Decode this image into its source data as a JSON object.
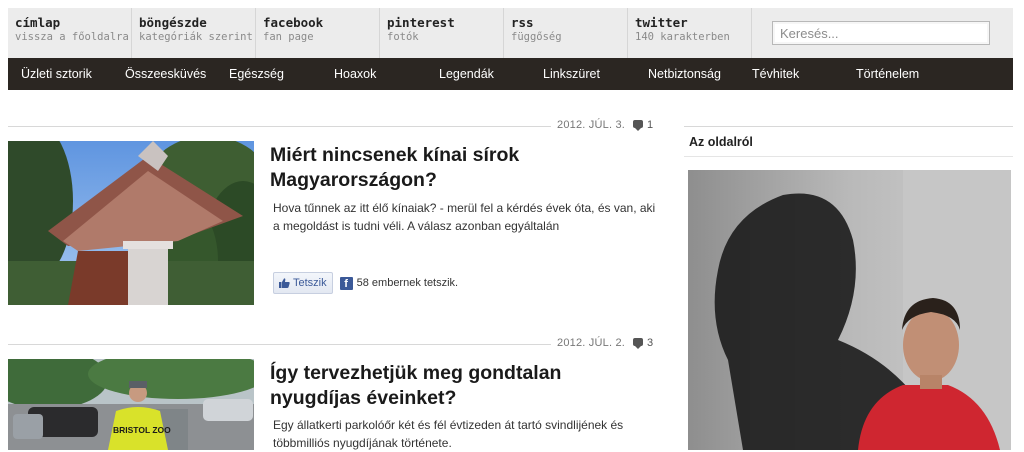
{
  "topnav": [
    {
      "title": "címlap",
      "subtitle": "vissza a főoldalra"
    },
    {
      "title": "böngészde",
      "subtitle": "kategóriák szerint"
    },
    {
      "title": "facebook",
      "subtitle": "fan page"
    },
    {
      "title": "pinterest",
      "subtitle": "fotók"
    },
    {
      "title": "rss",
      "subtitle": "függőség"
    },
    {
      "title": "twitter",
      "subtitle": "140 karakterben"
    }
  ],
  "search": {
    "placeholder": "Keresés..."
  },
  "categories": [
    "Üzleti sztorik",
    "Összeesküvés",
    "Egészség",
    "Hoaxok",
    "Legendák",
    "Linkszüret",
    "Netbiztonság",
    "Tévhitek",
    "Történelem"
  ],
  "articles": [
    {
      "date": "2012. JÚL. 3.",
      "comments": "1",
      "title": "Miért nincsenek kínai sírok Magyarországon?",
      "excerpt": "Hova tűnnek az itt élő kínaiak? - merül fel a kérdés évek óta, és van, aki a megoldást is tudni véli. A válasz azonban egyáltalán",
      "like_label": "Tetszik",
      "like_count": "58 embernek tetszik."
    },
    {
      "date": "2012. JÚL. 2.",
      "comments": "3",
      "title": "Így tervezhetjük meg gondtalan nyugdíjas éveinket?",
      "excerpt": "Egy állatkerti parkolóőr két és fél évtizeden át tartó svindlijének és többmilliós nyugdíjának története.",
      "photo_text": "BRISTOL ZOO"
    }
  ],
  "sidebar": {
    "title": "Az oldalról"
  },
  "colors": {
    "topbar": "#ececec",
    "catbar": "#2b2622",
    "fb_blue": "#3b5998"
  }
}
